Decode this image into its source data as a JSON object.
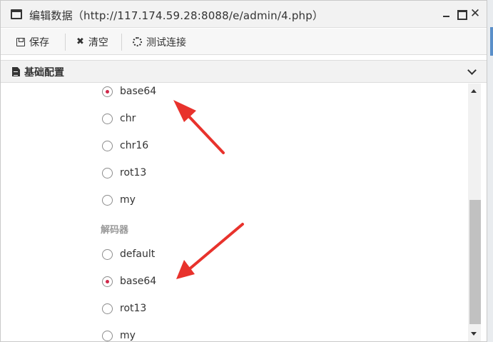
{
  "window": {
    "title": "编辑数据（http://117.174.59.28:8088/e/admin/4.php）",
    "controls": {
      "minimize": "minimize",
      "maximize": "maximize",
      "close": "✕"
    }
  },
  "toolbar": {
    "save_label": "保存",
    "clear_label": "清空",
    "test_label": "测试连接",
    "clear_icon": "✖"
  },
  "section": {
    "title": "基础配置"
  },
  "encoder_options": [
    {
      "label": "base64",
      "checked": true
    },
    {
      "label": "chr",
      "checked": false
    },
    {
      "label": "chr16",
      "checked": false
    },
    {
      "label": "rot13",
      "checked": false
    },
    {
      "label": "my",
      "checked": false
    }
  ],
  "decoder_group": {
    "label": "解码器",
    "options": [
      {
        "label": "default",
        "checked": false
      },
      {
        "label": "base64",
        "checked": true
      },
      {
        "label": "rot13",
        "checked": false
      },
      {
        "label": "my",
        "checked": false
      }
    ]
  },
  "colors": {
    "arrow": "#e8322c",
    "radio_checked": "#d0284a"
  }
}
